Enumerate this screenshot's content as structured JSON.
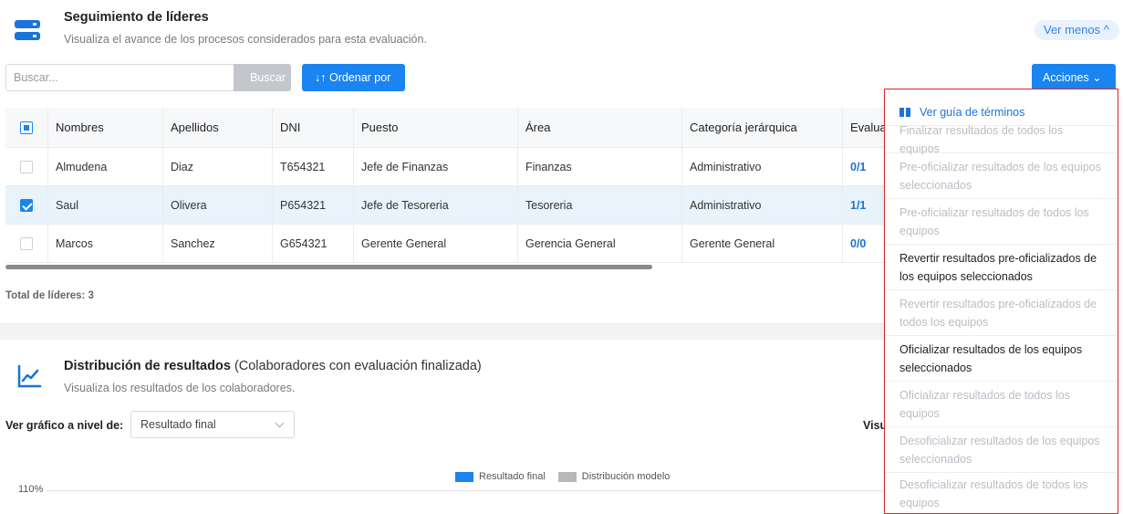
{
  "header": {
    "title": "Seguimiento de líderes",
    "subtitle": "Visualiza el avance de los procesos considerados para esta evaluación.",
    "toggle_label": "Ver menos ^"
  },
  "search": {
    "placeholder": "Buscar...",
    "button_label": "Buscar",
    "order_label": "↓↑ Ordenar por",
    "actions_label": "Acciones ⌄"
  },
  "table": {
    "columns": [
      "Nombres",
      "Apellidos",
      "DNI",
      "Puesto",
      "Área",
      "Categoría jerárquica",
      "Evaluac"
    ],
    "rows": [
      {
        "nombre": "Almudena",
        "apellido": "Diaz",
        "dni": "T654321",
        "puesto": "Jefe de Finanzas",
        "area": "Finanzas",
        "categoria": "Administrativo",
        "eval": "0/1",
        "checked": false
      },
      {
        "nombre": "Saul",
        "apellido": "Olivera",
        "dni": "P654321",
        "puesto": "Jefe de Tesoreria",
        "area": "Tesoreria",
        "categoria": "Administrativo",
        "eval": "1/1",
        "checked": true
      },
      {
        "nombre": "Marcos",
        "apellido": "Sanchez",
        "dni": "G654321",
        "puesto": "Gerente General",
        "area": "Gerencia General",
        "categoria": "Gerente General",
        "eval": "0/0",
        "checked": false
      }
    ],
    "total": "Total de líderes: 3"
  },
  "distribution": {
    "title_bold": "Distribución de resultados",
    "title_rest": "(Colaboradores con evaluación finalizada)",
    "subtitle": "Visualiza los resultados de los colaboradores.",
    "level_label": "Ver gráfico a nivel de:",
    "level_value": "Resultado final",
    "right_label": "Visu",
    "legend": [
      "Resultado final",
      "Distribución modelo"
    ],
    "ytick": "110%",
    "colors": {
      "resultado_final": "#1a84f0",
      "distribucion_modelo": "#b8b8b8"
    }
  },
  "menu": {
    "guide": "Ver guía de términos",
    "items": [
      {
        "label": "Finalizar resultados de todos los equipos",
        "enabled": false
      },
      {
        "label": "Pre-oficializar resultados de los equipos seleccionados",
        "enabled": false
      },
      {
        "label": "Pre-oficializar resultados de todos los equipos",
        "enabled": false
      },
      {
        "label": "Revertir resultados pre-oficializados de los equipos seleccionados",
        "enabled": true
      },
      {
        "label": "Revertir resultados pre-oficializados de todos los equipos",
        "enabled": false
      },
      {
        "label": "Oficializar resultados de los equipos seleccionados",
        "enabled": true
      },
      {
        "label": "Oficializar resultados de todos los equipos",
        "enabled": false
      },
      {
        "label": "Desoficializar resultados de los equipos seleccionados",
        "enabled": false
      },
      {
        "label": "Desoficializar resultados de todos los equipos",
        "enabled": false
      }
    ]
  },
  "colors": {
    "primary": "#1a84f0",
    "link": "#1a73d9",
    "selected_row": "#e8f3fc",
    "menu_outline": "#e4252b"
  }
}
